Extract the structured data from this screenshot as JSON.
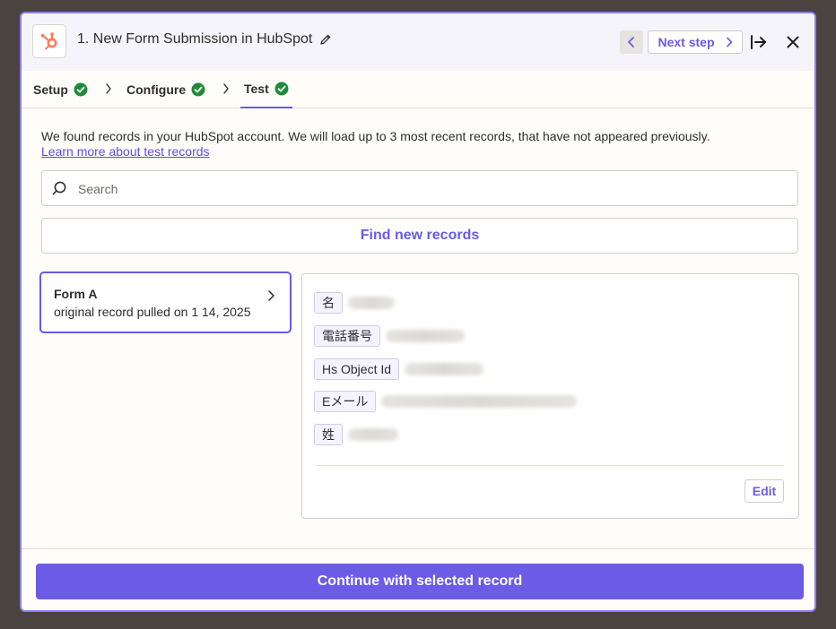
{
  "header": {
    "title": "1. New Form Submission in HubSpot",
    "next_label": "Next step"
  },
  "tabs": [
    {
      "label": "Setup",
      "status": "complete"
    },
    {
      "label": "Configure",
      "status": "complete"
    },
    {
      "label": "Test",
      "status": "complete",
      "active": true
    }
  ],
  "info": {
    "message": "We found records in your HubSpot account. We will load up to 3 most recent records, that have not appeared previously.",
    "link": "Learn more about test records"
  },
  "search": {
    "placeholder": "Search",
    "value": ""
  },
  "find_button": "Find new records",
  "records": [
    {
      "name": "Form A",
      "subtitle": "original record pulled on 1 14, 2025",
      "selected": true
    }
  ],
  "record_fields": [
    {
      "key": "名",
      "redacted": true
    },
    {
      "key": "電話番号",
      "redacted": true
    },
    {
      "key": "Hs Object Id",
      "redacted": true
    },
    {
      "key": "Eメール",
      "redacted": true
    },
    {
      "key": "姓",
      "redacted": true
    }
  ],
  "edit_button": "Edit",
  "continue_button": "Continue with selected record",
  "colors": {
    "accent": "#695be8",
    "success": "#1f8a3a",
    "hubspot": "#ff7a59"
  }
}
